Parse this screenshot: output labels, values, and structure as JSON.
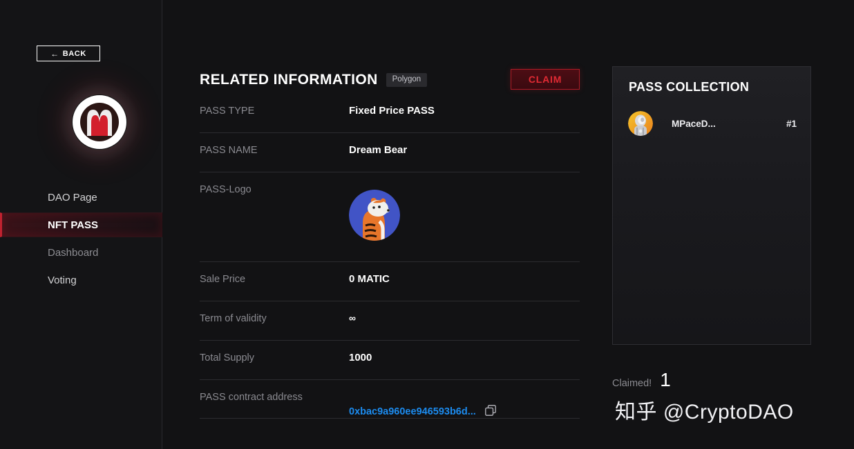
{
  "sidebar": {
    "back_label": "BACK",
    "back_arrow": "←",
    "logo_icon": "dao-m-logo-icon",
    "items": [
      {
        "label": "DAO Page",
        "active": false
      },
      {
        "label": "NFT PASS",
        "active": true
      },
      {
        "label": "Dashboard",
        "active": false
      },
      {
        "label": "Voting",
        "active": false
      }
    ]
  },
  "main": {
    "title": "RELATED INFORMATION",
    "chain_badge": "Polygon",
    "claim_label": "CLAIM",
    "rows": [
      {
        "label": "PASS TYPE",
        "value": "Fixed Price PASS"
      },
      {
        "label": "PASS NAME",
        "value": "Dream Bear"
      },
      {
        "label": "PASS-Logo",
        "value": ""
      },
      {
        "label": "Sale Price",
        "value": "0 MATIC"
      },
      {
        "label": "Term of validity",
        "value": "∞"
      },
      {
        "label": "Total Supply",
        "value": "1000"
      },
      {
        "label": "PASS contract address",
        "value": "0xbac9a960ee946593b6d..."
      }
    ],
    "pass_logo_icon": "tiger-avatar-icon",
    "copy_icon": "copy-icon"
  },
  "collection": {
    "title": "PASS COLLECTION",
    "items": [
      {
        "avatar_icon": "astronaut-avatar-icon",
        "name": "MPaceD...",
        "index": "#1"
      }
    ]
  },
  "footer": {
    "claimed_label": "Claimed!",
    "claimed_count": "1",
    "watermark": "知乎 @CryptoDAO"
  },
  "colors": {
    "background": "#121214",
    "sidebar": "#141416",
    "accent_red": "#c0222f",
    "claim_text": "#e12a33",
    "link_blue": "#1c8cf0",
    "label_gray": "#8a8a90",
    "panel_top": "#202024"
  }
}
